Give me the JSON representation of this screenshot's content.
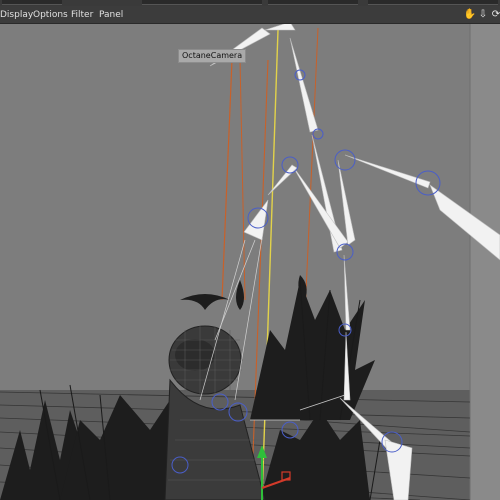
{
  "menubar": {
    "items": [
      "Display",
      "Options",
      "Filter",
      "Panel"
    ]
  },
  "nav_icons": [
    "hand-move-icon",
    "arrow-down-icon",
    "rotate-icon",
    "maximize-icon"
  ],
  "viewport": {
    "camera_label": "OctaneCamera"
  },
  "colors": {
    "menubar_bg": "#3c3c3c",
    "viewport_bg": "#7b7b7b",
    "bone_fill": "#f2f2f2",
    "bone_outline": "#bfbfbf",
    "joint_ring": "#4a5ec8",
    "spline_orange": "#c8612a",
    "spline_yellow": "#e2d24a",
    "axis_green": "#2fbf3a",
    "axis_red": "#d33a2a"
  }
}
